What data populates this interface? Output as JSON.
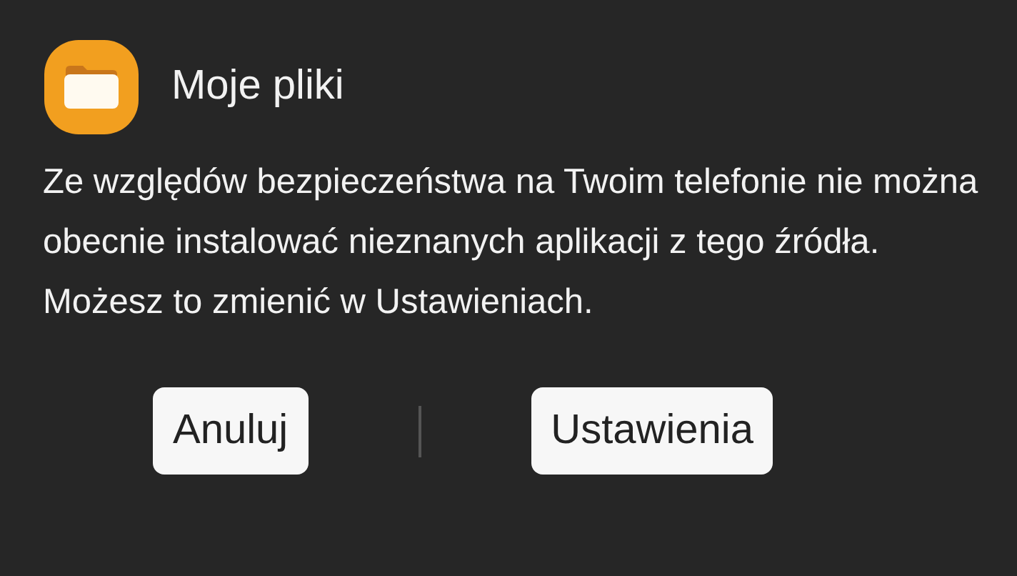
{
  "dialog": {
    "app_name": "Moje pliki",
    "message": "Ze względów bezpieczeństwa na Twoim telefonie nie można obecnie instalować nieznanych aplikacji z tego źródła. Możesz to zmienić w Ustawieniach.",
    "buttons": [
      {
        "label": "Anuluj"
      },
      {
        "label": "Ustawienia"
      }
    ]
  }
}
